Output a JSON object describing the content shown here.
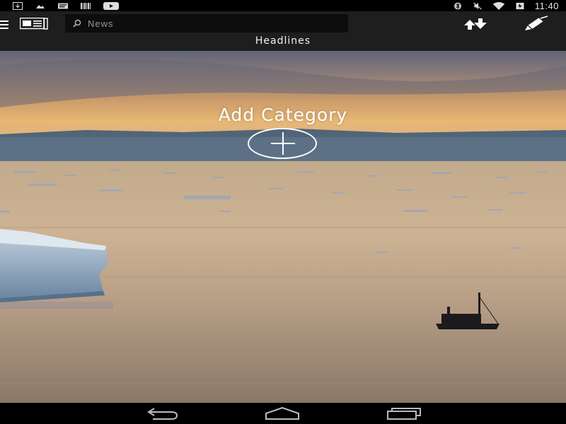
{
  "status_bar": {
    "left_icons": [
      "download-icon",
      "image-icon",
      "message-icon",
      "barcode-icon",
      "youtube-icon"
    ],
    "right_icons": [
      "bluetooth-icon",
      "mute-icon",
      "wifi-icon",
      "battery-icon"
    ],
    "time": "11:40"
  },
  "app_bar": {
    "menu_icon": "hamburger-icon",
    "app_icon": "newspaper-icon",
    "search": {
      "placeholder": "News",
      "value": ""
    },
    "download_icon": "download-arrows-icon",
    "edit_icon": "pen-icon",
    "section_title": "Headlines"
  },
  "main": {
    "add_category_label": "Add Category",
    "add_icon": "plus-icon"
  },
  "nav_bar": {
    "buttons": [
      "back-icon",
      "home-icon",
      "recents-icon"
    ]
  },
  "colors": {
    "app_bar_bg": "#1e1e1e",
    "status_bar_bg": "#000000",
    "nav_bar_bg": "#000000",
    "text": "#ffffff"
  }
}
